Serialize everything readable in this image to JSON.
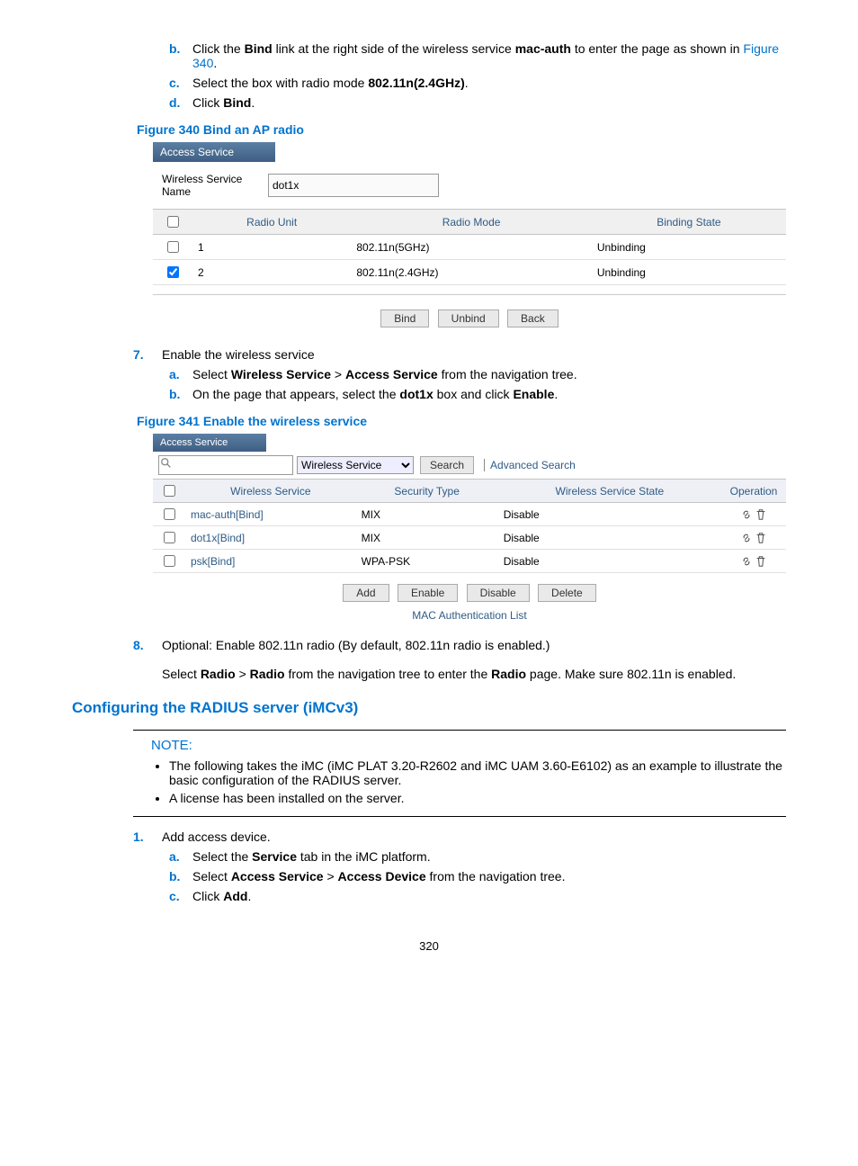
{
  "steps": {
    "b": {
      "letter": "b.",
      "pre": "Click the ",
      "bind": "Bind",
      "mid": " link at the right side of the wireless service ",
      "mac": "mac-auth",
      "mid2": " to enter the page as shown in ",
      "figref": "Figure 340",
      "post": "."
    },
    "c": {
      "letter": "c.",
      "pre": "Select the box with radio mode ",
      "mode": "802.11n(2.4GHz)",
      "post": "."
    },
    "d": {
      "letter": "d.",
      "pre": "Click ",
      "bind": "Bind",
      "post": "."
    }
  },
  "fig340": {
    "caption": "Figure 340 Bind an AP radio",
    "titlebar": "Access Service",
    "nameLabel": "Wireless Service Name",
    "nameValue": "dot1x",
    "cols": {
      "unit": "Radio Unit",
      "mode": "Radio Mode",
      "state": "Binding State"
    },
    "rows": [
      {
        "checked": false,
        "unit": "1",
        "mode": "802.11n(5GHz)",
        "state": "Unbinding"
      },
      {
        "checked": true,
        "unit": "2",
        "mode": "802.11n(2.4GHz)",
        "state": "Unbinding"
      }
    ],
    "btns": {
      "bind": "Bind",
      "unbind": "Unbind",
      "back": "Back"
    }
  },
  "step7": {
    "num": "7.",
    "title": "Enable the wireless service",
    "a": {
      "letter": "a.",
      "pre": "Select ",
      "ws": "Wireless Service",
      "gt": " > ",
      "as": "Access Service",
      "post": " from the navigation tree."
    },
    "b": {
      "letter": "b.",
      "pre": "On the page that appears, select the ",
      "dot1x": "dot1x",
      "mid": " box and click ",
      "enable": "Enable",
      "post": "."
    }
  },
  "fig341": {
    "caption": "Figure 341 Enable the wireless service",
    "titlebar": "Access Service",
    "searchSelect": "Wireless Service",
    "searchBtn": "Search",
    "advanced": "Advanced Search",
    "cols": {
      "name": "Wireless Service",
      "sec": "Security Type",
      "state": "Wireless Service State",
      "op": "Operation"
    },
    "rows": [
      {
        "name": "mac-auth[Bind]",
        "sec": "MIX",
        "state": "Disable"
      },
      {
        "name": "dot1x[Bind]",
        "sec": "MIX",
        "state": "Disable"
      },
      {
        "name": "psk[Bind]",
        "sec": "WPA-PSK",
        "state": "Disable"
      }
    ],
    "btns": {
      "add": "Add",
      "enable": "Enable",
      "disable": "Disable",
      "delete": "Delete"
    },
    "maclist": "MAC Authentication List"
  },
  "step8": {
    "num": "8.",
    "line1": "Optional: Enable 802.11n radio (By default, 802.11n radio is enabled.)",
    "line2pre": "Select ",
    "radio": "Radio",
    "gt": " > ",
    "radio2": "Radio",
    "mid": " from the navigation tree to enter the ",
    "radio3": "Radio",
    "post": " page. Make sure 802.11n is enabled."
  },
  "h2": "Configuring the RADIUS server (iMCv3)",
  "note": {
    "label": "NOTE:",
    "items": [
      "The following takes the iMC (iMC PLAT 3.20-R2602 and iMC UAM 3.60-E6102) as an example to illustrate the basic configuration of the RADIUS server.",
      "A license has been installed on the server."
    ]
  },
  "step1": {
    "num": "1.",
    "title": "Add access device.",
    "a": {
      "letter": "a.",
      "pre": "Select the ",
      "svc": "Service",
      "post": " tab in the iMC platform."
    },
    "b": {
      "letter": "b.",
      "pre": "Select ",
      "as": "Access Service",
      "gt": " > ",
      "ad": "Access Device",
      "post": " from the navigation tree."
    },
    "c": {
      "letter": "c.",
      "pre": "Click ",
      "add": "Add",
      "post": "."
    }
  },
  "pagenum": "320"
}
